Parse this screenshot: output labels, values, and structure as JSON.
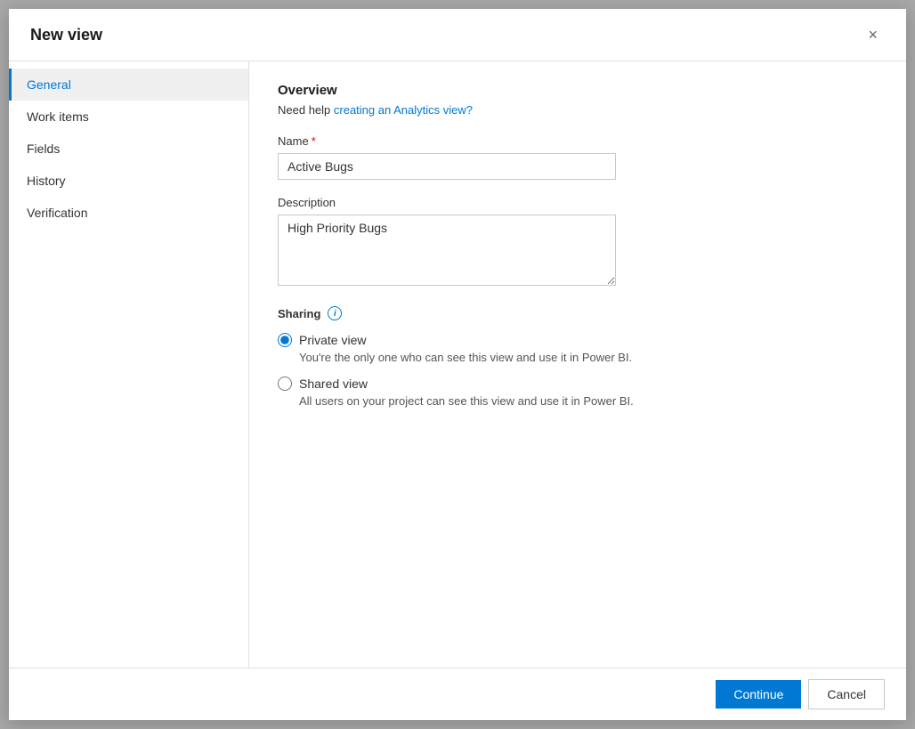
{
  "dialog": {
    "title": "New view",
    "close_label": "×"
  },
  "sidebar": {
    "items": [
      {
        "id": "general",
        "label": "General",
        "active": true
      },
      {
        "id": "work-items",
        "label": "Work items",
        "active": false
      },
      {
        "id": "fields",
        "label": "Fields",
        "active": false
      },
      {
        "id": "history",
        "label": "History",
        "active": false
      },
      {
        "id": "verification",
        "label": "Verification",
        "active": false
      }
    ]
  },
  "content": {
    "overview_title": "Overview",
    "help_text_prefix": "Need help ",
    "help_link_label": "creating an Analytics view?",
    "name_label": "Name",
    "name_value": "Active Bugs",
    "name_placeholder": "",
    "description_label": "Description",
    "description_value": "High Priority Bugs",
    "sharing_label": "Sharing",
    "info_icon": "i",
    "radio_options": [
      {
        "id": "private",
        "label": "Private view",
        "description": "You're the only one who can see this view and use it in Power BI.",
        "checked": true
      },
      {
        "id": "shared",
        "label": "Shared view",
        "description": "All users on your project can see this view and use it in Power BI.",
        "checked": false
      }
    ]
  },
  "footer": {
    "continue_label": "Continue",
    "cancel_label": "Cancel"
  }
}
